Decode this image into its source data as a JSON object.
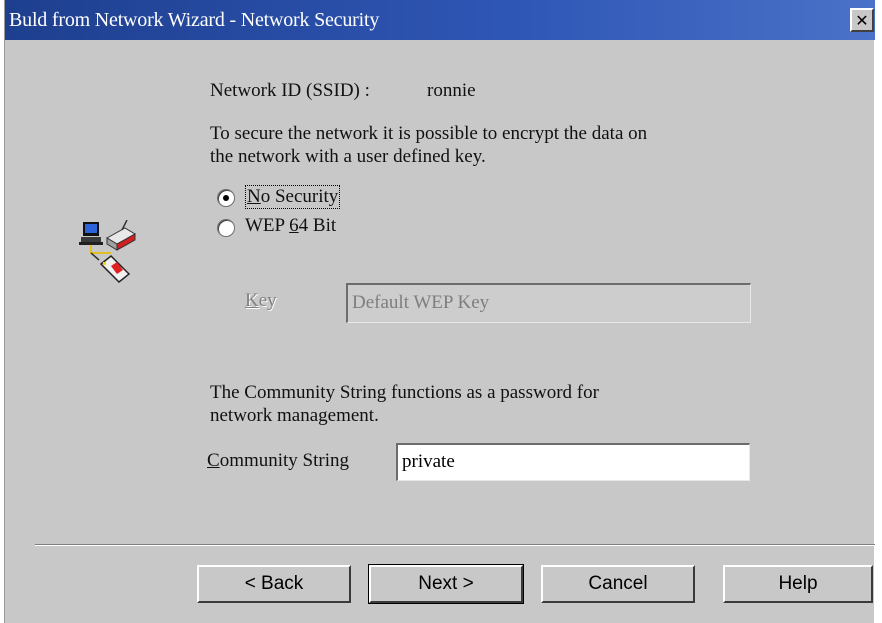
{
  "window": {
    "title": "Buld from Network Wizard - Network Security",
    "close_glyph": "✕"
  },
  "ssid": {
    "label": "Network ID (SSID) :",
    "value": "ronnie"
  },
  "encryption": {
    "description_line1": "To secure the network it is possible to encrypt the data on",
    "description_line2": "the network with a user defined key.",
    "options": [
      {
        "label": "No Security",
        "accel": "N",
        "rest": "o Security",
        "selected": true
      },
      {
        "label": "WEP 64 Bit",
        "prefix": "WEP ",
        "accel": "6",
        "rest": "4 Bit",
        "selected": false
      }
    ]
  },
  "key": {
    "label": "Key",
    "accel": "K",
    "rest": "ey",
    "value": "Default WEP Key",
    "enabled": false
  },
  "community": {
    "description_line1": "The Community String functions as a password for",
    "description_line2": "network management.",
    "label": "Community String",
    "accel": "C",
    "rest": "ommunity String",
    "value": "private"
  },
  "buttons": {
    "back": "< Back",
    "next": "Next >",
    "cancel": "Cancel",
    "help": "Help"
  },
  "icons": {
    "wizard_graphic": "network-computer-icon"
  }
}
